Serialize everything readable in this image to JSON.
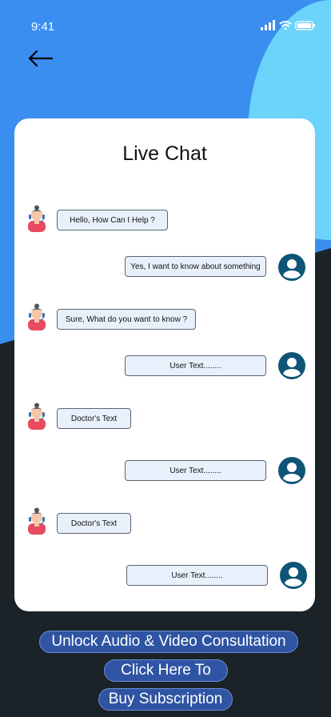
{
  "status_bar": {
    "time": "9:41",
    "icons": [
      "signal-icon",
      "wifi-icon",
      "battery-icon"
    ]
  },
  "nav": {
    "back_icon": "arrow-left-icon"
  },
  "chat": {
    "title": "Live Chat",
    "messages": [
      {
        "sender": "doctor",
        "text": "Hello, How Can I Help ?"
      },
      {
        "sender": "user",
        "text": "Yes, I want to know about something"
      },
      {
        "sender": "doctor",
        "text": "Sure, What do you want to know ?"
      },
      {
        "sender": "user",
        "text": "User Text........"
      },
      {
        "sender": "doctor",
        "text": "Doctor's Text"
      },
      {
        "sender": "user",
        "text": "User Text........"
      },
      {
        "sender": "doctor",
        "text": "Doctor's Text"
      },
      {
        "sender": "user",
        "text": "User Text........"
      }
    ]
  },
  "actions": {
    "unlock_label": "Unlock Audio & Video Consultation",
    "click_label": "Click Here To",
    "subscribe_label": "Buy Subscription"
  },
  "colors": {
    "background_blue": "#3a8ef0",
    "accent_light_blue": "#6cd3fb",
    "dark": "#1b2329",
    "user_avatar": "#0e5477",
    "button": "#2f54a3"
  }
}
